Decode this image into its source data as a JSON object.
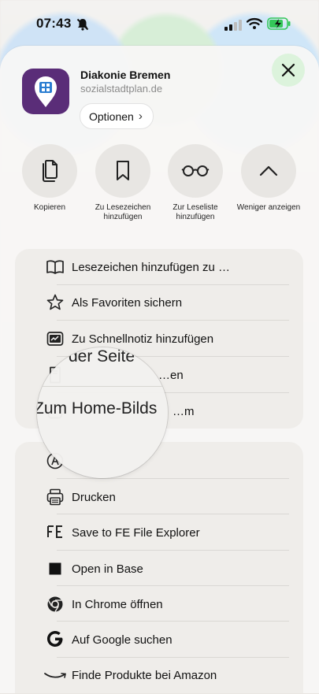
{
  "status": {
    "time": "07:43"
  },
  "site": {
    "name": "Diakonie Bremen",
    "url": "sozialstadtplan.de",
    "options_label": "Optionen"
  },
  "actions": [
    {
      "label": "Kopieren",
      "icon": "copy-icon"
    },
    {
      "label": "Zu Lesezeichen hinzufügen",
      "icon": "bookmark-icon"
    },
    {
      "label": "Zur Leseliste hinzufügen",
      "icon": "glasses-icon"
    },
    {
      "label": "Weniger anzeigen",
      "icon": "chevron-up-icon"
    }
  ],
  "menu_group_1": [
    {
      "label": "Lesezeichen hinzufügen zu …",
      "icon": "book-icon"
    },
    {
      "label": "Als Favoriten sichern",
      "icon": "star-icon"
    },
    {
      "label": "Zu Schnellnotiz hinzufügen",
      "icon": "quicknote-icon"
    },
    {
      "label": "…en",
      "icon": "page-search-icon"
    },
    {
      "label": "…m",
      "icon": "add-square-icon"
    }
  ],
  "menu_group_2": [
    {
      "label": "",
      "icon": "markup-icon"
    },
    {
      "label": "Drucken",
      "icon": "printer-icon"
    },
    {
      "label": "Save to FE File Explorer",
      "icon": "fe-icon"
    },
    {
      "label": "Open in Base",
      "icon": "base-square-icon"
    },
    {
      "label": "In Chrome öffnen",
      "icon": "chrome-icon"
    },
    {
      "label": "Auf Google suchen",
      "icon": "google-icon"
    },
    {
      "label": "Finde Produkte bei Amazon",
      "icon": "amazon-icon"
    }
  ],
  "magnifier": {
    "line1": "der Seite",
    "line2": "Zum Home-Bilds"
  },
  "colors": {
    "app_icon_bg": "#5a2d78",
    "close_button_bg": "#dcf3dc",
    "battery_charging": "#34c759"
  }
}
